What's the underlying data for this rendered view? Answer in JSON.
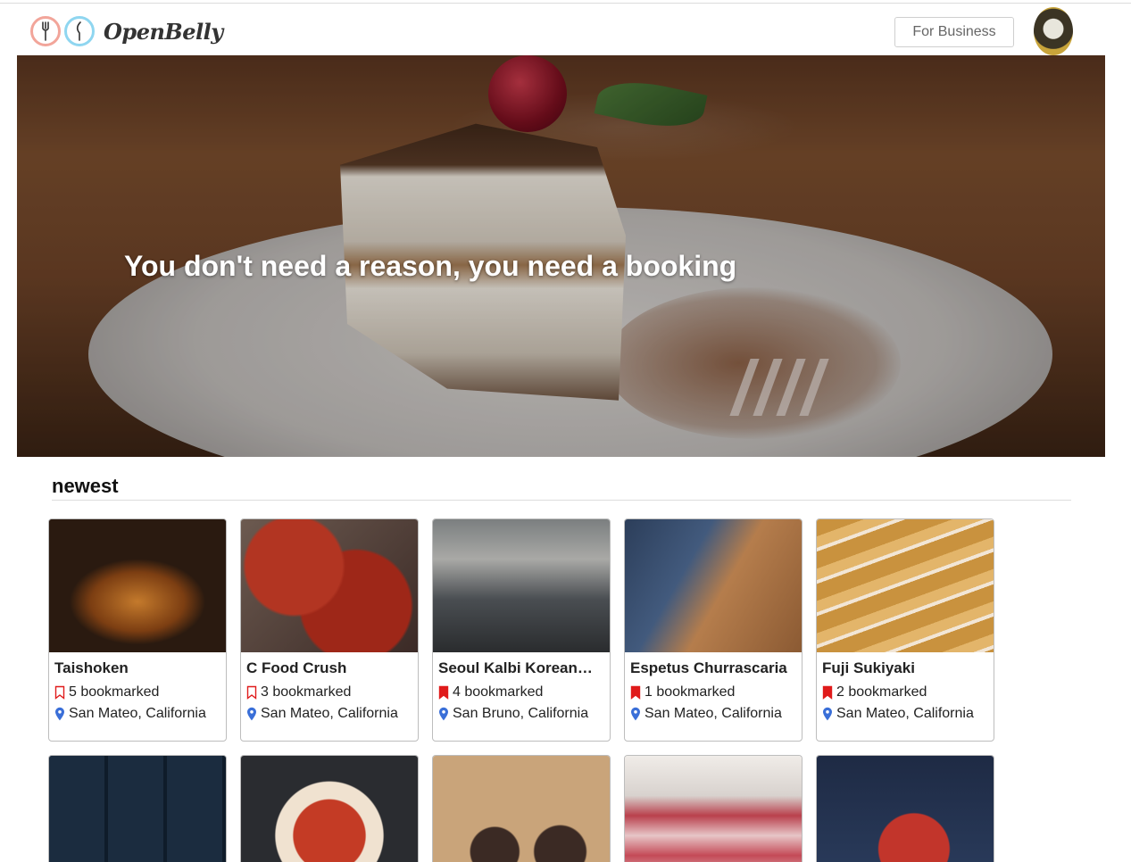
{
  "header": {
    "logo_text": "OpenBelly",
    "for_business_label": "For Business"
  },
  "hero": {
    "title": "You don't need a reason, you need a booking"
  },
  "sections": {
    "newest": {
      "title": "newest",
      "cards": [
        {
          "name": "Taishoken",
          "bookmarks": "5 bookmarked",
          "bookmarked_by_user": false,
          "location": "San Mateo, California"
        },
        {
          "name": "C Food Crush",
          "bookmarks": "3 bookmarked",
          "bookmarked_by_user": false,
          "location": "San Mateo, California"
        },
        {
          "name": "Seoul Kalbi Korean…",
          "bookmarks": "4 bookmarked",
          "bookmarked_by_user": true,
          "location": "San Bruno, California"
        },
        {
          "name": "Espetus Churrascaria",
          "bookmarks": "1 bookmarked",
          "bookmarked_by_user": true,
          "location": "San Mateo, California"
        },
        {
          "name": "Fuji Sukiyaki",
          "bookmarks": "2 bookmarked",
          "bookmarked_by_user": true,
          "location": "San Mateo, California"
        }
      ]
    }
  },
  "colors": {
    "bookmark_icon": "#e01b1b",
    "location_icon": "#3a6fd8",
    "logo_fork_ring": "#f2a59a",
    "logo_knife_ring": "#8fd6f0"
  },
  "icons": {
    "logo_left": "fork-icon",
    "logo_right": "knife-icon",
    "bookmark_outline": "bookmark-outline-icon",
    "bookmark_filled": "bookmark-filled-icon",
    "location": "map-pin-icon"
  }
}
